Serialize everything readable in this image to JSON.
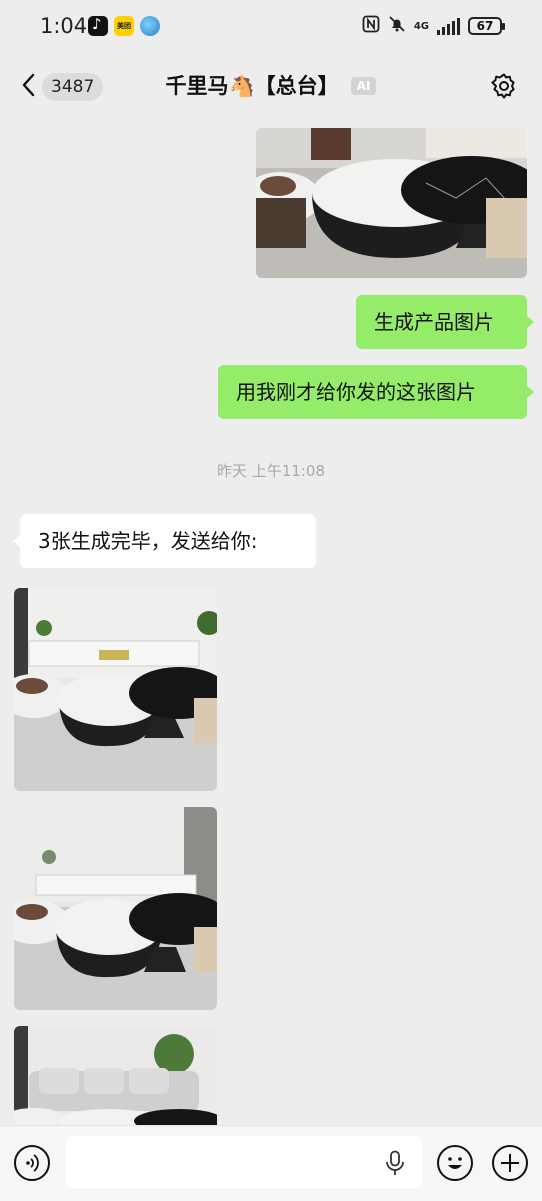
{
  "status_bar": {
    "time": "1:04",
    "app_icons": [
      "tiktok-icon",
      "meituan-icon",
      "globe-icon"
    ],
    "meituan_label": "美团",
    "network": "4G",
    "battery": "67"
  },
  "header": {
    "back_count": "3487",
    "title": "千里马🐴【总台】",
    "ai_badge": "AI"
  },
  "messages": [
    {
      "type": "image",
      "from": "me",
      "description_icon": "product-photo"
    },
    {
      "type": "text",
      "from": "me",
      "text": "生成产品图片"
    },
    {
      "type": "text",
      "from": "me",
      "text": "用我刚才给你发的这张图片"
    },
    {
      "type": "timestamp",
      "text": "昨天 上午11:08"
    },
    {
      "type": "text",
      "from": "other",
      "text": "3张生成完毕，发送给你:"
    },
    {
      "type": "image",
      "from": "other"
    },
    {
      "type": "image",
      "from": "other"
    },
    {
      "type": "image",
      "from": "other"
    }
  ],
  "bottom_bar": {
    "icons": [
      "voice-icon",
      "mic-icon",
      "emoji-icon",
      "plus-icon"
    ]
  },
  "colors": {
    "background": "#ededed",
    "my_bubble": "#95ec69",
    "their_bubble": "#ffffff",
    "bottom_bar": "#f6f6f6"
  }
}
